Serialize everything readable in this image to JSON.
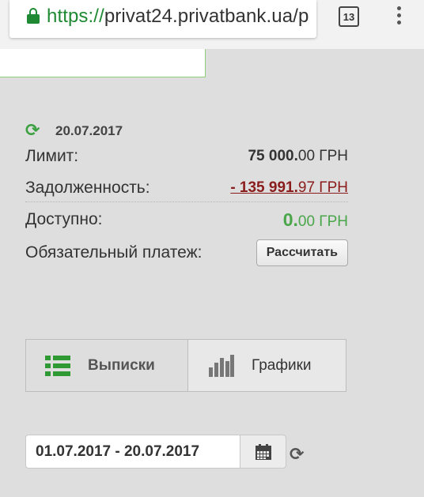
{
  "browser": {
    "url_scheme": "https://",
    "url_host": "privat24.privatbank.ua/p",
    "tab_count": "13"
  },
  "card": {
    "date": "20.07.2017",
    "limit_label": "Лимит:",
    "limit_int": "75 000.",
    "limit_frac": "00 ГРН",
    "debt_label": "Задолженность:",
    "debt_int": "- 135 991.",
    "debt_frac": "97 ГРН",
    "available_label": "Доступно:",
    "available_int": "0.",
    "available_frac": "00 ГРН",
    "payment_label": "Обязательный платеж:",
    "calc_button": "Рассчитать"
  },
  "tabs": {
    "statements": "Выписки",
    "charts": "Графики"
  },
  "period": {
    "range": "01.07.2017 - 20.07.2017"
  },
  "colors": {
    "accent_green": "#2f9a34",
    "debt_red": "#8b1c1c"
  }
}
